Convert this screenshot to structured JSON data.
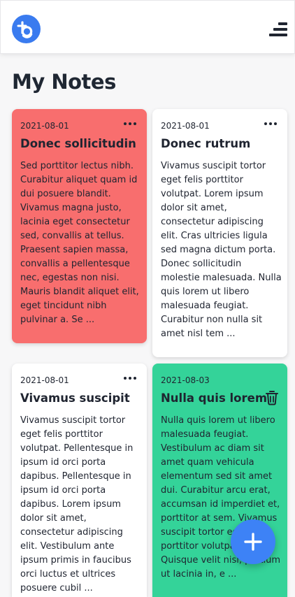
{
  "header": {
    "logo_icon": "logo-icon",
    "menu_icon": "menu-icon"
  },
  "page": {
    "title": "My Notes"
  },
  "notes": [
    {
      "date": "2021-08-01",
      "title": "Donec sollicitudin",
      "body": "Sed porttitor lectus nibh. Curabitur aliquet quam id dui posuere blandit. Vivamus magna justo, lacinia eget consectetur sed, convallis at tellus. Praesent sapien massa, convallis a pellentesque nec, egestas non nisi. Mauris blandit aliquet elit, eget tincidunt nibh pulvinar a. Se ...",
      "color": "#f86e6e"
    },
    {
      "date": "2021-08-01",
      "title": "Donec rutrum",
      "body": "Vivamus suscipit tortor eget felis porttitor volutpat. Lorem ipsum dolor sit amet, consectetur adipiscing elit. Cras ultricies ligula sed magna dictum porta. Donec sollicitudin molestie malesuada. Nulla quis lorem ut libero malesuada feugiat. Curabitur non nulla sit amet nisl tem ...",
      "color": "#ffffff"
    },
    {
      "date": "2021-08-01",
      "title": "Vivamus suscipit",
      "body": "Vivamus suscipit tortor eget felis porttitor volutpat. Pellentesque in ipsum id orci porta dapibus. Pellentesque in ipsum id orci porta dapibus. Lorem ipsum dolor sit amet, consectetur adipiscing elit. Vestibulum ante ipsum primis in faucibus orci luctus et ultrices posuere cubil ...",
      "color": "#ffffff"
    },
    {
      "date": "2021-08-03",
      "title": "Nulla quis lorem",
      "body": "Nulla quis lorem ut libero malesuada feugiat. Vestibulum ac diam sit amet quam vehicula elementum sed sit amet dui. Curabitur arcu erat, accumsan id imperdiet et, porttitor at sem. Vivamus suscipit tortor eget felis porttitor volutpat. Quisque velit nisi, pretium ut lacinia in, e ...",
      "color": "#34d399"
    }
  ],
  "icons": {
    "more": "more-horizontal-icon",
    "trash": "trash-icon",
    "add": "plus-icon"
  },
  "colors": {
    "accent": "#3d82f6",
    "red_note": "#f86e6e",
    "green_note": "#34d399"
  }
}
